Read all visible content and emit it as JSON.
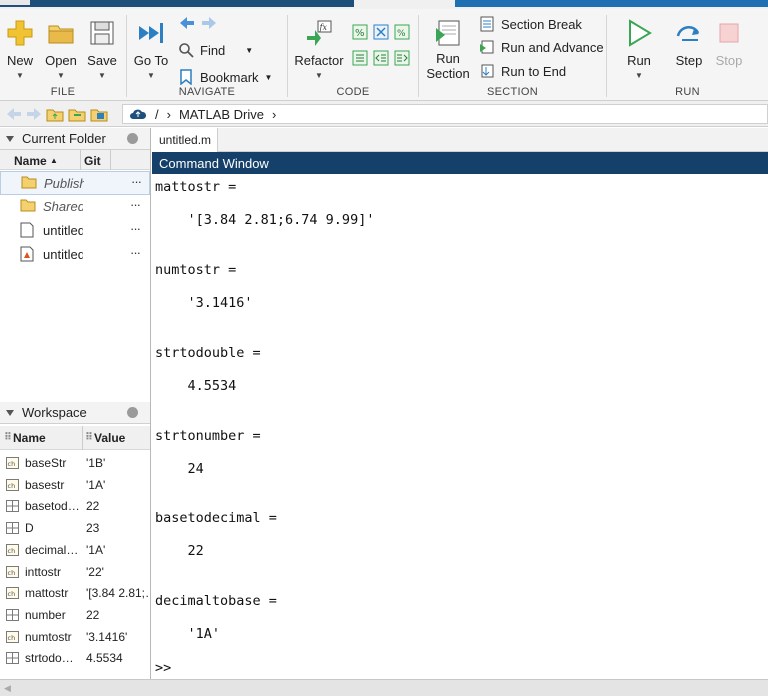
{
  "ribbon": {
    "file": {
      "group_label": "FILE",
      "new_label": "New",
      "open_label": "Open",
      "save_label": "Save"
    },
    "navigate": {
      "group_label": "NAVIGATE",
      "goto_label": "Go To",
      "find_label": "Find",
      "bookmark_label": "Bookmark"
    },
    "code": {
      "group_label": "CODE",
      "refactor_label": "Refactor"
    },
    "section": {
      "group_label": "SECTION",
      "run_section_label_1": "Run",
      "run_section_label_2": "Section",
      "section_break_label": "Section Break",
      "run_and_advance_label": "Run and Advance",
      "run_to_end_label": "Run to End"
    },
    "run": {
      "group_label": "RUN",
      "run_label": "Run",
      "step_label": "Step",
      "stop_label": "Stop"
    }
  },
  "address": {
    "root": "/",
    "folder": "MATLAB Drive"
  },
  "current_folder": {
    "title": "Current Folder",
    "col_name": "Name",
    "col_git": "Git",
    "items": [
      {
        "name": "Publish",
        "italic": true
      },
      {
        "name": "Shared",
        "italic": true
      },
      {
        "name": "untitled",
        "italic": false
      },
      {
        "name": "untitled",
        "italic": false
      }
    ]
  },
  "workspace": {
    "title": "Workspace",
    "col_name": "Name",
    "col_value": "Value",
    "vars": [
      {
        "name": "baseStr",
        "value": "'1B'",
        "type": "char"
      },
      {
        "name": "basestr",
        "value": "'1A'",
        "type": "char"
      },
      {
        "name": "basetod…",
        "value": "22",
        "type": "num"
      },
      {
        "name": "D",
        "value": "23",
        "type": "num"
      },
      {
        "name": "decimal…",
        "value": "'1A'",
        "type": "char"
      },
      {
        "name": "inttostr",
        "value": "'22'",
        "type": "char"
      },
      {
        "name": "mattostr",
        "value": "'[3.84 2.81;…",
        "type": "char"
      },
      {
        "name": "number",
        "value": "22",
        "type": "num"
      },
      {
        "name": "numtostr",
        "value": "'3.1416'",
        "type": "char"
      },
      {
        "name": "strtodo…",
        "value": "4.5534",
        "type": "num"
      }
    ]
  },
  "editor": {
    "tab": "untitled.m"
  },
  "command_window": {
    "title": "Command Window",
    "lines": [
      "mattostr =",
      "    '[3.84 2.81;6.74 9.99]'",
      "numtostr =",
      "    '3.1416'",
      "strtodouble =",
      "    4.5534",
      "strtonumber =",
      "    24",
      "basetodecimal =",
      "    22",
      "decimaltobase =",
      "    '1A'",
      ">>"
    ]
  },
  "colors": {
    "ribbon_blue": "#1e4f7a",
    "command_header": "#14406a",
    "run_green": "#3aa655",
    "icon_blue": "#2d7fc4",
    "folder_yellow": "#e9b949"
  }
}
